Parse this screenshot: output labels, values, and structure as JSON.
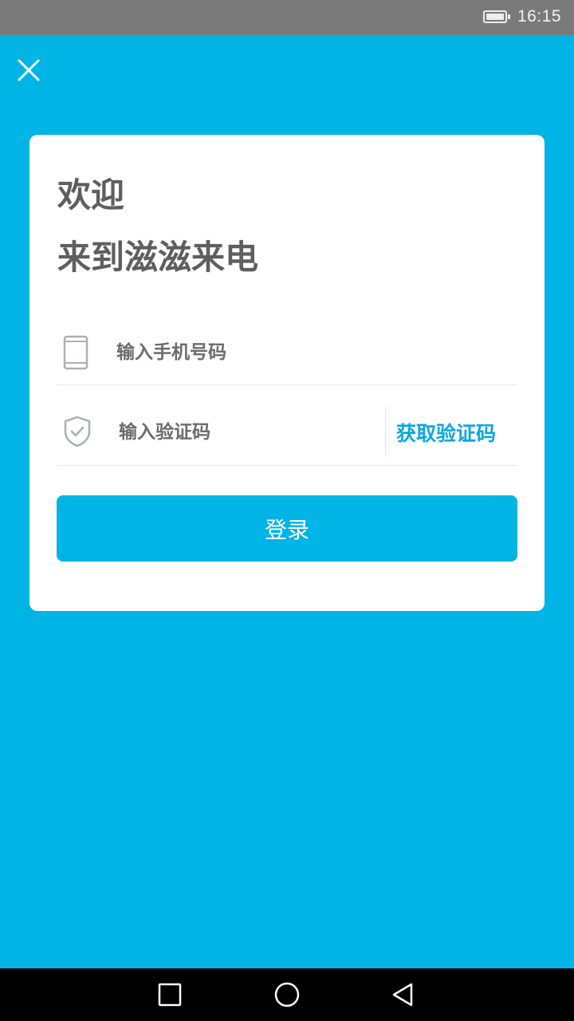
{
  "status_bar": {
    "time": "16:15",
    "battery_icon": "battery-icon"
  },
  "header": {
    "close_icon": "close-icon"
  },
  "card": {
    "welcome_title": "欢迎",
    "welcome_subtitle": "来到滋滋来电",
    "phone_field": {
      "icon": "phone-icon",
      "placeholder": "输入手机号码",
      "value": ""
    },
    "code_field": {
      "icon": "shield-check-icon",
      "placeholder": "输入验证码",
      "value": ""
    },
    "get_code_label": "获取验证码",
    "login_label": "登录"
  },
  "nav_bar": {
    "recent_icon": "recent-apps-icon",
    "home_icon": "home-icon",
    "back_icon": "back-icon"
  },
  "colors": {
    "background": "#00B4E6",
    "card": "#FFFFFF",
    "accent_text": "#0AA8E0",
    "status_bar": "#7A7A7A",
    "nav_bar": "#000000"
  }
}
